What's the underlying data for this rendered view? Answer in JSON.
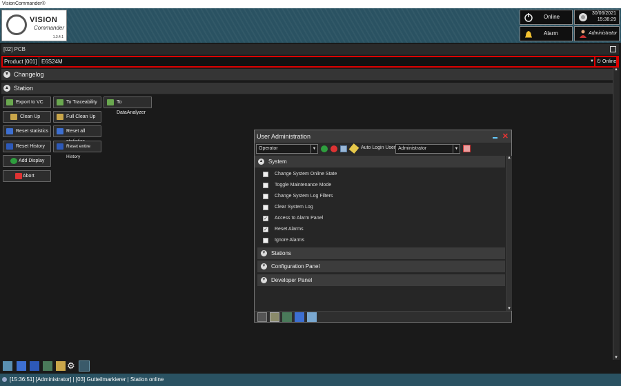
{
  "window": {
    "title": "VisionCommander®"
  },
  "logo": {
    "line1": "VISION",
    "line2": "Commander",
    "version": "1.3.4.1"
  },
  "header": {
    "online_label": "Online",
    "date": "30/06/2021",
    "time": "15:38:29",
    "alarm_label": "Alarm",
    "user_label": "Administrator"
  },
  "breadcrumb": "[02] PCB",
  "product": {
    "label": "Product [001]",
    "value": "E6S24M",
    "online_button": "Online"
  },
  "sections": {
    "changelog": "Changelog",
    "station": "Station"
  },
  "actions": [
    {
      "label": "Export to VC",
      "icon": "export-icon"
    },
    {
      "label": "To Traceability",
      "icon": "traceability-icon"
    },
    {
      "label": "To DataAnalyzer",
      "icon": "data-analyzer-icon"
    },
    {
      "label": "Clean Up",
      "icon": "broom-icon"
    },
    {
      "label": "Full Clean Up",
      "icon": "broom-full-icon"
    },
    {
      "label": "Reset statistics",
      "icon": "statistics-icon"
    },
    {
      "label": "Reset all statistics",
      "icon": "statistics-all-icon"
    },
    {
      "label": "Reset History",
      "icon": "history-icon"
    },
    {
      "label": "Reset entire History",
      "icon": "history-all-icon"
    },
    {
      "label": "Add Display",
      "icon": "add-icon"
    },
    {
      "label": "Abort",
      "icon": "abort-icon"
    }
  ],
  "dialog": {
    "title": "User Administration",
    "role_select": "Operator",
    "auto_login_label": "Auto Login User:",
    "auto_login_value": "Administrator",
    "system_section": "System",
    "permissions": [
      {
        "label": "Change System Online State",
        "checked": false
      },
      {
        "label": "Toggle Maintenance Mode",
        "checked": false
      },
      {
        "label": "Change System Log Filters",
        "checked": false
      },
      {
        "label": "Clear System Log",
        "checked": false
      },
      {
        "label": "Access to Alarm Panel",
        "checked": true
      },
      {
        "label": "Reset Alarms",
        "checked": true
      },
      {
        "label": "Ignore Alarms",
        "checked": false
      }
    ],
    "collapsed_sections": [
      "Stations",
      "Configuration Panel",
      "Developer Panel"
    ]
  },
  "status": {
    "text": "[15:36:51] [Administrator] | [03] Gutteilmarkierer | Station online"
  },
  "colors": {
    "header_bg": "#2a5262",
    "highlight_red": "#dd0000",
    "accent_green": "#2e9e3e"
  }
}
